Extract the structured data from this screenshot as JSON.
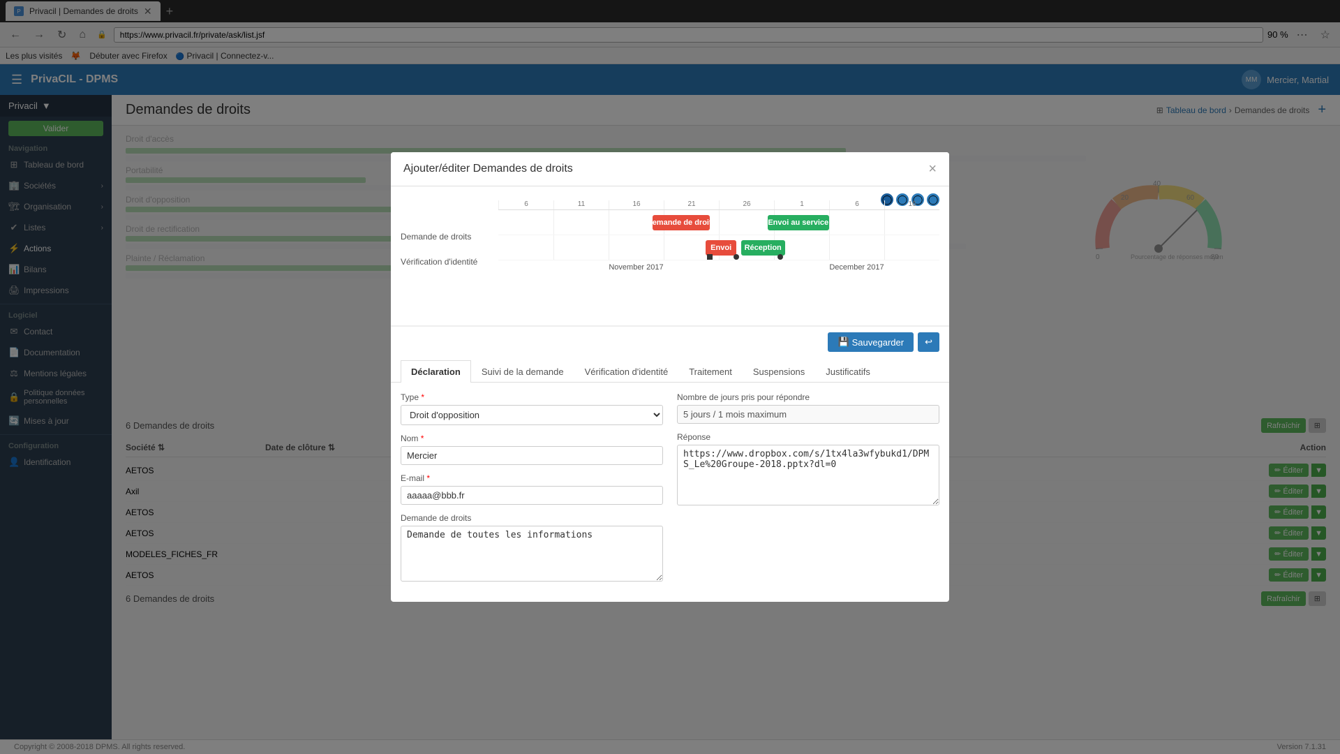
{
  "browser": {
    "tab_label": "Privacil | Demandes de droits",
    "address": "https://www.privacil.fr/private/ask/list.jsf",
    "zoom": "90 %",
    "bookmarks": [
      "Les plus visités",
      "Débuter avec Firefox",
      "Privacil | Connectez-v..."
    ]
  },
  "app": {
    "logo": "PrivaCIL - DPMS",
    "user": "Mercier, Martial",
    "page_title": "Demandes de droits",
    "breadcrumb_home": "Tableau de bord",
    "breadcrumb_current": "Demandes de droits"
  },
  "sidebar": {
    "brand_label": "Privacil",
    "validate_label": "Valider",
    "nav_label": "Navigation",
    "items": [
      {
        "id": "tableau-de-bord",
        "label": "Tableau de bord",
        "icon": "⊞"
      },
      {
        "id": "societes",
        "label": "Sociétés",
        "icon": "🏢",
        "arrow": "‹"
      },
      {
        "id": "organisation",
        "label": "Organisation",
        "icon": "🏗",
        "arrow": "‹"
      },
      {
        "id": "listes",
        "label": "Listes",
        "icon": "≡",
        "arrow": "‹"
      },
      {
        "id": "actions",
        "label": "Actions",
        "icon": "⚡"
      },
      {
        "id": "bilans",
        "label": "Bilans",
        "icon": "📊"
      },
      {
        "id": "impressions",
        "label": "Impressions",
        "icon": "🖨"
      }
    ],
    "logiciel_label": "Logiciel",
    "logiciel_items": [
      {
        "id": "contact",
        "label": "Contact",
        "icon": "✉"
      },
      {
        "id": "documentation",
        "label": "Documentation",
        "icon": "📄"
      },
      {
        "id": "mentions-legales",
        "label": "Mentions légales",
        "icon": "⚖"
      },
      {
        "id": "politique-donnees",
        "label": "Politique données personnelles",
        "icon": "🔒"
      },
      {
        "id": "mises-a-jour",
        "label": "Mises à jour",
        "icon": "🔄"
      }
    ],
    "config_label": "Configuration",
    "config_items": [
      {
        "id": "identification",
        "label": "Identification",
        "icon": "👤"
      }
    ]
  },
  "main": {
    "refresh_label": "Rafraîchir",
    "count_label": "6 Demandes de droits",
    "date_cloture_label": "Date de clôture",
    "action_label": "Action",
    "societe_label": "Société",
    "rows": [
      {
        "societe": "AETOS",
        "date": ""
      },
      {
        "societe": "Axil",
        "date": ""
      },
      {
        "societe": "AETOS",
        "date": ""
      },
      {
        "societe": "AETOS",
        "date": ""
      },
      {
        "societe": "MODELES_FICHES_FR",
        "date": ""
      },
      {
        "societe": "AETOS",
        "date": ""
      }
    ],
    "edit_label": "Éditer",
    "footer_copyright": "Copyright © 2008-2018 DPMS. All rights reserved.",
    "footer_version": "Version 7.1.31"
  },
  "modal": {
    "title": "Ajouter/éditer Demandes de droits",
    "save_label": "Sauvegarder",
    "tabs": [
      {
        "id": "declaration",
        "label": "Déclaration",
        "active": true
      },
      {
        "id": "suivi",
        "label": "Suivi de la demande"
      },
      {
        "id": "verification",
        "label": "Vérification d'identité"
      },
      {
        "id": "traitement",
        "label": "Traitement"
      },
      {
        "id": "suspensions",
        "label": "Suspensions"
      },
      {
        "id": "justificatifs",
        "label": "Justificatifs"
      }
    ],
    "form": {
      "type_label": "Type",
      "type_value": "Droit d'opposition",
      "type_options": [
        "Droit d'accès",
        "Droit d'opposition",
        "Portabilité",
        "Droit de rectification",
        "Plainte / Réclamation"
      ],
      "nom_label": "Nom",
      "nom_required": true,
      "nom_value": "Mercier",
      "email_label": "E-mail",
      "email_required": true,
      "email_value": "aaaaa@bbb.fr",
      "demande_label": "Demande de droits",
      "demande_value": "Demande de toutes les informations",
      "jours_label": "Nombre de jours pris pour répondre",
      "jours_value": "5 jours / 1 mois maximum",
      "reponse_label": "Réponse",
      "reponse_value": "https://www.dropbox.com/s/1tx4la3wfybukd1/DPMS_Le%20Groupe-2018.pptx?dl=0"
    },
    "gantt": {
      "rows": [
        {
          "label": "Demande de droits"
        },
        {
          "label": "Vérification d'identité"
        }
      ],
      "bars": [
        {
          "label": "Demande de droits",
          "color": "red",
          "left": "37%",
          "width": "12%"
        },
        {
          "label": "Envoi au service",
          "color": "green",
          "left": "63%",
          "width": "12%"
        },
        {
          "label": "Réception",
          "color": "green",
          "left": "57%",
          "width": "9%",
          "row": 1
        },
        {
          "label": "Envoi",
          "color": "red",
          "left": "50%",
          "width": "6%",
          "row": 1
        }
      ],
      "months": [
        "November 2017",
        "December 2017"
      ],
      "ticks": [
        "6",
        "11",
        "16",
        "21",
        "26",
        "1",
        "6",
        "16"
      ]
    }
  }
}
